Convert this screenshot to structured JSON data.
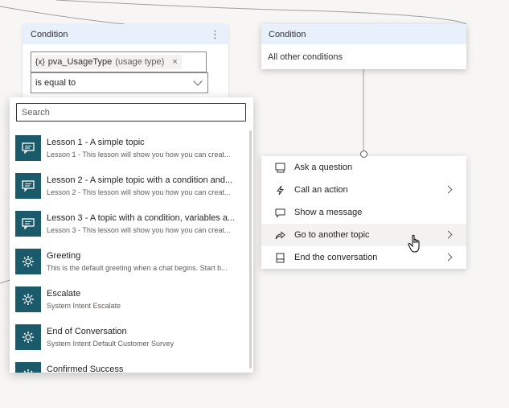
{
  "condition_left": {
    "title": "Condition",
    "menu_glyph": "⋮",
    "variable_icon": "{x}",
    "variable_name": "pva_UsageType",
    "variable_type": "(usage type)",
    "remove_glyph": "×",
    "operator": "is equal to"
  },
  "condition_right": {
    "title": "Condition",
    "body": "All other conditions"
  },
  "topic_picker": {
    "search_placeholder": "Search",
    "topics": [
      {
        "name": "Lesson 1 - A simple topic",
        "desc": "Lesson 1 - This lesson will show you how you can creat...",
        "icon": "chat-bubble-icon"
      },
      {
        "name": "Lesson 2 - A simple topic with a condition and...",
        "desc": "Lesson 2 - This lesson will show you how you can creat...",
        "icon": "chat-bubble-icon"
      },
      {
        "name": "Lesson 3 - A topic with a condition, variables a...",
        "desc": "Lesson 3 - This lesson will show you how you can creat...",
        "icon": "chat-bubble-icon"
      },
      {
        "name": "Greeting",
        "desc": "This is the default greeting when a chat begins. Start b...",
        "icon": "system-gear-icon"
      },
      {
        "name": "Escalate",
        "desc": "System Intent Escalate",
        "icon": "system-gear-icon"
      },
      {
        "name": "End of Conversation",
        "desc": "System Intent Default Customer Survey",
        "icon": "system-gear-icon"
      },
      {
        "name": "Confirmed Success",
        "desc": "",
        "icon": "system-gear-icon"
      }
    ]
  },
  "action_menu": {
    "items": [
      {
        "label": "Ask a question",
        "icon": "question-icon",
        "has_submenu": false
      },
      {
        "label": "Call an action",
        "icon": "lightning-icon",
        "has_submenu": true
      },
      {
        "label": "Show a message",
        "icon": "message-icon",
        "has_submenu": false
      },
      {
        "label": "Go to another topic",
        "icon": "redirect-arrow-icon",
        "has_submenu": true
      },
      {
        "label": "End the conversation",
        "icon": "end-icon",
        "has_submenu": true
      }
    ]
  }
}
